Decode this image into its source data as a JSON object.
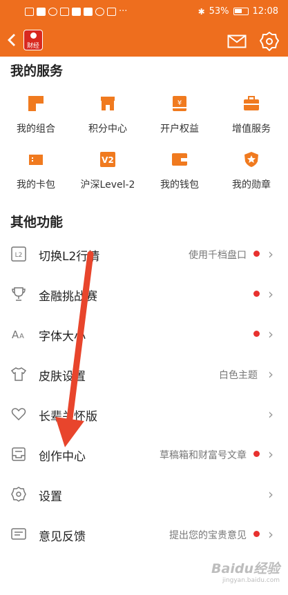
{
  "status_bar": {
    "left_icons": [
      "hd-icon",
      "signal-icon",
      "wifi-icon",
      "app-icon",
      "app-icon",
      "app-icon",
      "chat-icon",
      "search-app-icon"
    ],
    "more": "···",
    "battery_text": "53%",
    "time": "12:08"
  },
  "header": {
    "logo_text": "财经",
    "accent": "#ee6e1e"
  },
  "services": {
    "title": "我的服务",
    "items": [
      {
        "label": "我的组合",
        "icon": "portfolio-icon"
      },
      {
        "label": "积分中心",
        "icon": "store-icon"
      },
      {
        "label": "开户权益",
        "icon": "yen-card-icon"
      },
      {
        "label": "增值服务",
        "icon": "briefcase-icon"
      },
      {
        "label": "我的卡包",
        "icon": "ticket-icon"
      },
      {
        "label": "沪深Level-2",
        "icon": "v2-icon"
      },
      {
        "label": "我的钱包",
        "icon": "wallet-icon"
      },
      {
        "label": "我的勋章",
        "icon": "medal-icon"
      }
    ]
  },
  "other": {
    "title": "其他功能",
    "rows": [
      {
        "label": "切换L2行情",
        "value": "使用千档盘口",
        "dot": true,
        "icon": "l2-icon"
      },
      {
        "label": "金融挑战赛",
        "value": "",
        "dot": true,
        "icon": "trophy-icon"
      },
      {
        "label": "字体大小",
        "value": "",
        "dot": true,
        "icon": "font-size-icon"
      },
      {
        "label": "皮肤设置",
        "value": "白色主题",
        "dot": false,
        "icon": "shirt-icon"
      },
      {
        "label": "长辈关怀版",
        "value": "",
        "dot": false,
        "icon": "heart-icon"
      },
      {
        "label": "创作中心",
        "value": "草稿箱和财富号文章",
        "dot": true,
        "icon": "inbox-icon"
      },
      {
        "label": "设置",
        "value": "",
        "dot": false,
        "icon": "settings-icon"
      },
      {
        "label": "意见反馈",
        "value": "提出您的宝贵意见",
        "dot": true,
        "icon": "feedback-icon"
      }
    ]
  },
  "watermark": {
    "text": "Baidu经验",
    "sub": "jingyan.baidu.com"
  },
  "colors": {
    "accent": "#ee6e1e",
    "dot": "#e8312f",
    "arrow": "#e8452c"
  }
}
